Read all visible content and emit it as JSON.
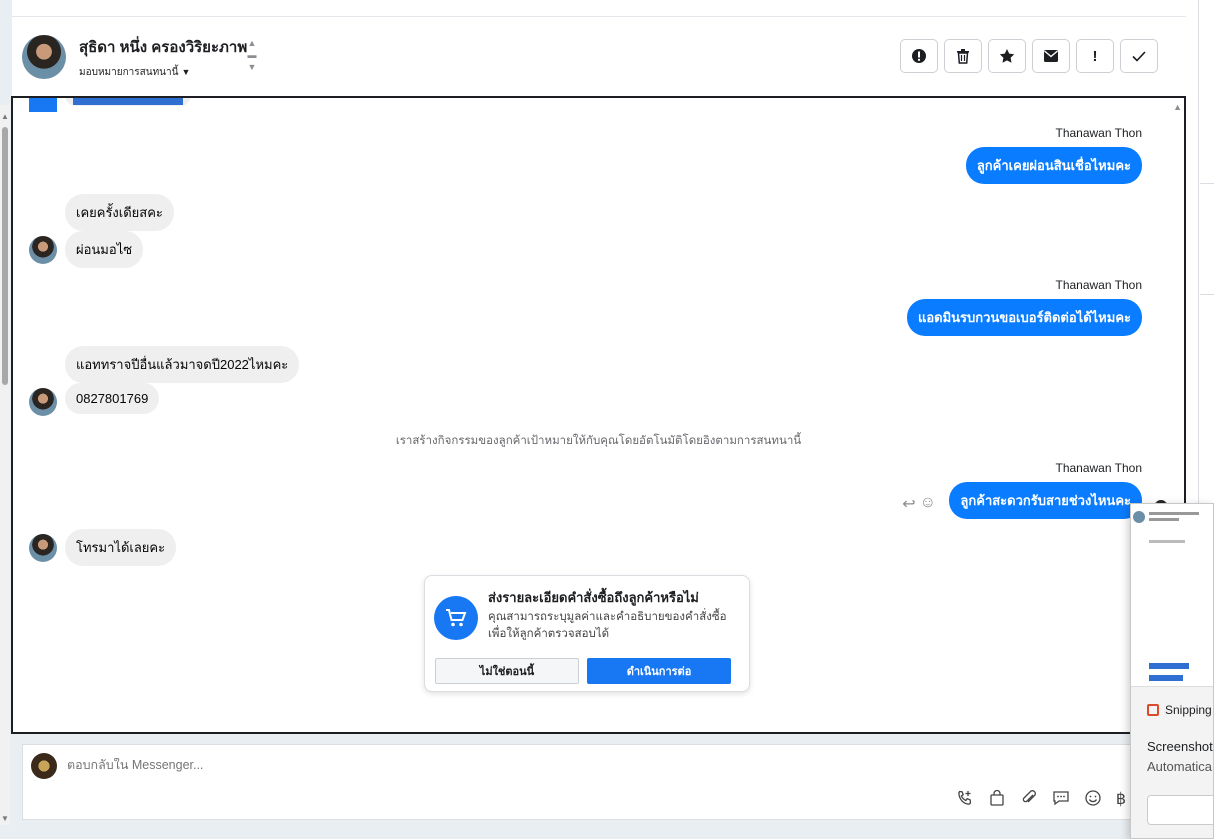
{
  "header": {
    "customer_name": "สุธิดา หนึ่ง ครองวิริยะภาพ",
    "assign_label": "มอบหมายการสนทนานี้",
    "toolbar_icons": [
      "alert-circle-icon",
      "trash-icon",
      "star-icon",
      "envelope-icon",
      "exclamation-icon",
      "check-icon"
    ]
  },
  "messages": [
    {
      "direction": "out",
      "sender": "Thanawan Thon",
      "text": "ลูกค้าเคยผ่อนสินเชื่อไหมคะ"
    },
    {
      "direction": "in",
      "text": "เคยครั้งเดียสคะ"
    },
    {
      "direction": "in",
      "text": "ผ่อนมอไซ"
    },
    {
      "direction": "out",
      "sender": "Thanawan Thon",
      "text": "แอดมินรบกวนขอเบอร์ติดต่อได้ไหมคะ"
    },
    {
      "direction": "in",
      "text": "แอททราจปีอื่นแล้วมาจดปี2022ไหมคะ"
    },
    {
      "direction": "in",
      "text": "0827801769"
    },
    {
      "direction": "system",
      "text": "เราสร้างกิจกรรมของลูกค้าเป้าหมายให้กับคุณโดยอัตโนมัติโดยอิงตามการสนทนานี้"
    },
    {
      "direction": "out",
      "sender": "Thanawan Thon",
      "text": "ลูกค้าสะดวกรับสายช่วงไหนคะ"
    },
    {
      "direction": "in",
      "text": "โทรมาได้เลยคะ"
    }
  ],
  "order_card": {
    "title": "ส่งรายละเอียดคำสั่งซื้อถึงลูกค้าหรือไม่",
    "description": "คุณสามารถระบุมูลค่าและคำอธิบายของคำสั่งซื้อเพื่อให้ลูกค้าตรวจสอบได้",
    "secondary_label": "ไม่ใช่ตอนนี้",
    "primary_label": "ดำเนินการต่อ"
  },
  "composer": {
    "placeholder": "ตอบกลับใน Messenger...",
    "tools": [
      "phone-plus-icon",
      "shopping-bag-icon",
      "paperclip-icon",
      "chat-template-icon",
      "emoji-icon",
      "baht-icon"
    ]
  },
  "snipping": {
    "app_name": "Snipping",
    "title": "Screenshot",
    "subtitle": "Automatica"
  }
}
